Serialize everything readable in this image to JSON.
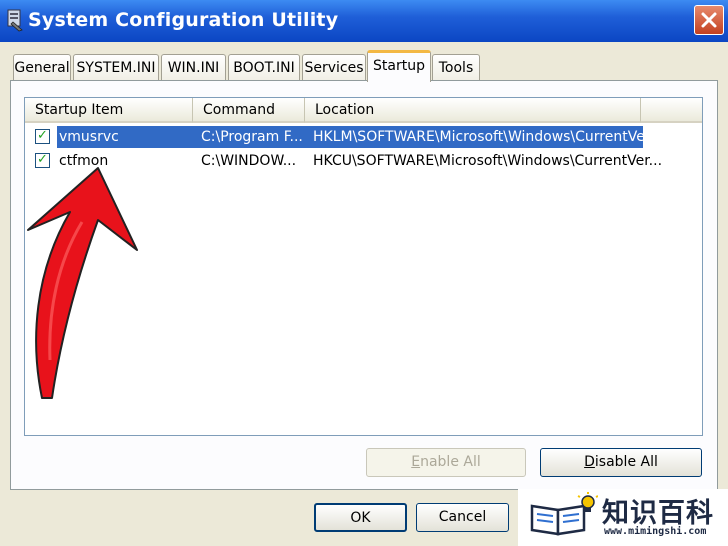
{
  "window": {
    "title": "System Configuration Utility"
  },
  "tabs": [
    "General",
    "SYSTEM.INI",
    "WIN.INI",
    "BOOT.INI",
    "Services",
    "Startup",
    "Tools"
  ],
  "active_tab": "Startup",
  "list": {
    "columns": [
      "Startup Item",
      "Command",
      "Location"
    ],
    "rows": [
      {
        "item": "vmusrvc",
        "command": "C:\\Program F...",
        "location": "HKLM\\SOFTWARE\\Microsoft\\Windows\\CurrentVer...",
        "checked": true,
        "selected": true
      },
      {
        "item": "ctfmon",
        "command": "C:\\WINDOW...",
        "location": "HKCU\\SOFTWARE\\Microsoft\\Windows\\CurrentVer...",
        "checked": true,
        "selected": false
      }
    ]
  },
  "buttons": {
    "enable_all_u": "E",
    "enable_all_rest": "nable All",
    "disable_all_u": "D",
    "disable_all_rest": "isable All",
    "ok": "OK",
    "cancel": "Cancel"
  },
  "watermark": {
    "name": "知识百科",
    "url": "www.mimingshi.com"
  },
  "colors": {
    "title_bar": "#0b46c3",
    "selection": "#316ac5",
    "annotation_arrow": "#e8121b",
    "check": "#21a121"
  }
}
